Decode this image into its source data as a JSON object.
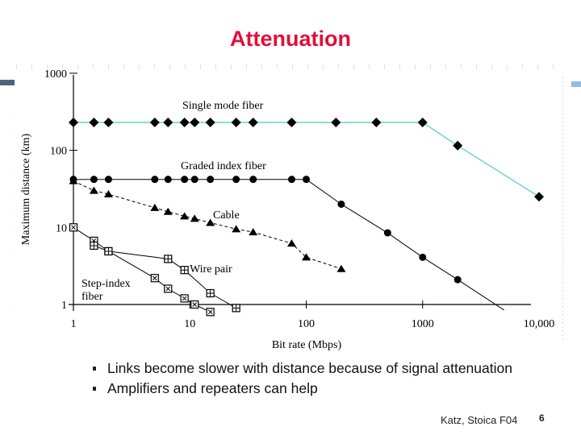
{
  "slide": {
    "title": "Attenuation",
    "bullets": [
      "Links become slower with distance because of signal attenuation",
      "Amplifiers and repeaters can help"
    ],
    "footer_credit": "Katz, Stoica F04",
    "page_number": "6",
    "colors": {
      "title": "#e0103a",
      "single_mode_line": "#5fd3d3",
      "ink": "#000000",
      "left_accent": "#4a6580",
      "right_accent": "#8fbde8"
    }
  },
  "chart_data": {
    "type": "line",
    "title": "",
    "xlabel": "Bit rate (Mbps)",
    "ylabel": "Maximum distance (km)",
    "xscale": "log",
    "yscale": "log",
    "xlim": [
      1,
      10000
    ],
    "ylim": [
      1,
      1000
    ],
    "x_ticks": [
      1,
      10,
      100,
      1000,
      10000
    ],
    "x_tick_labels": [
      "1",
      "10",
      "100",
      "1000",
      "10,000"
    ],
    "y_ticks": [
      1,
      10,
      100,
      1000
    ],
    "y_tick_labels": [
      "1",
      "10",
      "100",
      "1000"
    ],
    "grid": false,
    "legend": "inline labels",
    "series": [
      {
        "name": "Single mode fiber",
        "label": "Single mode fiber",
        "marker": "diamond",
        "line_color": "#5fd3d3",
        "x": [
          1,
          1.5,
          2,
          5,
          6.5,
          9,
          11,
          15,
          25,
          35,
          75,
          180,
          400,
          1000,
          2000,
          10000
        ],
        "y": [
          230,
          230,
          230,
          230,
          230,
          230,
          230,
          230,
          230,
          230,
          230,
          230,
          230,
          230,
          115,
          25
        ]
      },
      {
        "name": "Graded index fiber",
        "label": "Graded index fiber",
        "marker": "circle",
        "line_color": "#000000",
        "x": [
          1,
          1.5,
          2,
          5,
          6.5,
          9,
          11,
          15,
          25,
          35,
          75,
          100,
          200,
          500,
          1000,
          2000
        ],
        "y": [
          42,
          42,
          42,
          42,
          42,
          42,
          42,
          42,
          42,
          42,
          42,
          42,
          20,
          8.5,
          4.1,
          2.1
        ],
        "trend_end": {
          "x": 5000,
          "y": 0.85
        }
      },
      {
        "name": "Cable",
        "label": "Cable",
        "marker": "triangle",
        "line_color": "#000000",
        "x": [
          1,
          1.5,
          2,
          5,
          6.5,
          9,
          11,
          15,
          25,
          35,
          75,
          100,
          200
        ],
        "y": [
          40,
          30,
          27,
          18,
          16,
          14,
          13,
          11.5,
          9.5,
          8.7,
          6.2,
          4.1,
          2.9
        ]
      },
      {
        "name": "Step-index fiber",
        "label": "Step-index fiber",
        "marker": "square-x",
        "line_color": "#000000",
        "x": [
          1,
          1.5,
          2,
          5,
          6.5,
          9,
          11,
          15
        ],
        "y": [
          10,
          6.7,
          4.9,
          2.2,
          1.6,
          1.2,
          1.0,
          0.8
        ]
      },
      {
        "name": "Wire pair",
        "label": "Wire pair",
        "marker": "square-plus",
        "line_color": "#000000",
        "x": [
          1.5,
          2,
          6.5,
          9,
          15,
          25
        ],
        "y": [
          5.8,
          4.9,
          3.9,
          2.8,
          1.4,
          0.9
        ]
      }
    ]
  }
}
